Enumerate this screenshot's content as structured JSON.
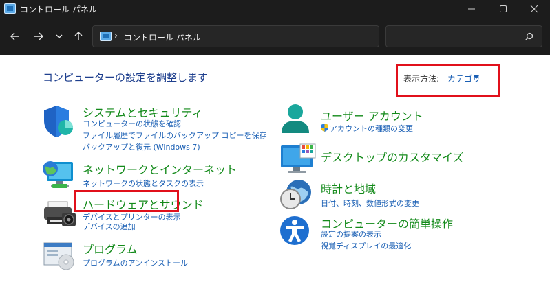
{
  "window": {
    "title": "コントロール パネル"
  },
  "address_bar": {
    "breadcrumb_sep": "›",
    "breadcrumb": [
      "コントロール パネル"
    ],
    "search_placeholder": ""
  },
  "main": {
    "page_title": "コンピューターの設定を調整します",
    "view_by": {
      "label": "表示方法:",
      "value": "カテゴリ"
    }
  },
  "categories_left": [
    {
      "title": "システムとセキュリティ",
      "links": [
        "コンピューターの状態を確認",
        "ファイル履歴でファイルのバックアップ コピーを保存",
        "バックアップと復元 (Windows 7)"
      ]
    },
    {
      "title": "ネットワークとインターネット",
      "links": [
        "ネットワークの状態とタスクの表示"
      ]
    },
    {
      "title": "ハードウェアとサウンド",
      "links": [
        "デバイスとプリンターの表示",
        "デバイスの追加"
      ]
    },
    {
      "title": "プログラム",
      "links": [
        "プログラムのアンインストール"
      ]
    }
  ],
  "categories_right": [
    {
      "title": "ユーザー アカウント",
      "links": [
        "アカウントの種類の変更"
      ]
    },
    {
      "title": "デスクトップのカスタマイズ",
      "links": []
    },
    {
      "title": "時計と地域",
      "links": [
        "日付、時刻、数値形式の変更"
      ]
    },
    {
      "title": "コンピューターの簡単操作",
      "links": [
        "設定の提案の表示",
        "視覚ディスプレイの最適化"
      ]
    }
  ],
  "colors": {
    "category_title": "#138a1a",
    "link": "#1a5fb4",
    "page_title": "#1e3f8e",
    "highlight": "#e1101b",
    "chrome": "#1c1c1c"
  },
  "icons": {
    "app": "control-panel-icon",
    "system": "shield-icon",
    "network": "globe-monitor-icon",
    "hardware": "printer-icon",
    "programs": "program-disc-icon",
    "user": "user-icon",
    "desktop": "desktop-monitor-icon",
    "clock": "clock-globe-icon",
    "access": "accessibility-icon"
  }
}
